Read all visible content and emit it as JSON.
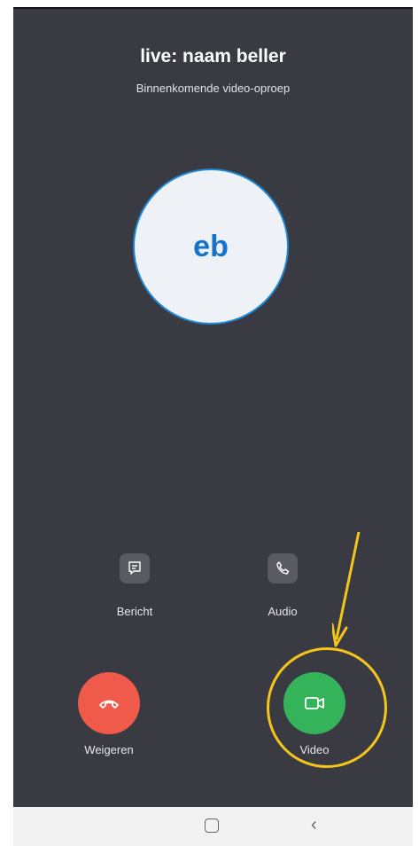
{
  "call": {
    "title": "live: naam beller",
    "subtitle": "Binnenkomende video-oproep",
    "avatar_initials": "eb"
  },
  "actions": {
    "message_label": "Bericht",
    "audio_label": "Audio",
    "decline_label": "Weigeren",
    "video_label": "Video"
  },
  "icons": {
    "message": "message-icon",
    "audio": "phone-icon",
    "decline": "hang-up-icon",
    "video": "video-camera-icon",
    "nav_home": "home-square-icon",
    "nav_back": "back-chevron-icon"
  },
  "colors": {
    "background": "#3a3a42",
    "avatar_text": "#1473cc",
    "decline": "#f05a4a",
    "accept": "#34b35a",
    "annotation": "#f4c51b"
  }
}
